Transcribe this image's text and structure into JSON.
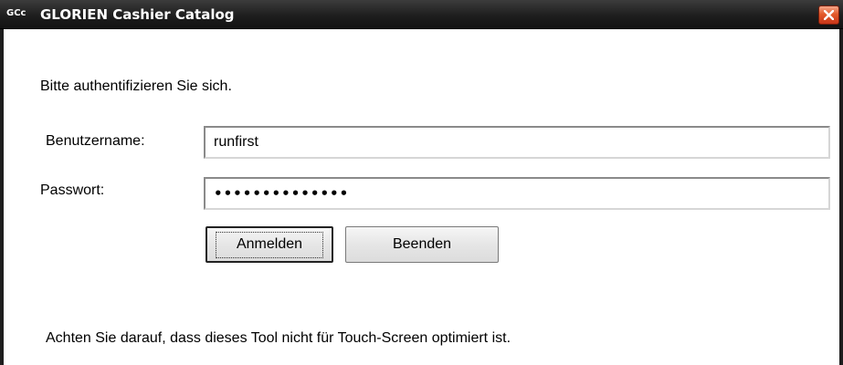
{
  "window": {
    "icon_text": "GCc",
    "title": "GLORIEN Cashier Catalog",
    "close_icon": "close-icon"
  },
  "login": {
    "prompt": "Bitte authentifizieren Sie sich.",
    "username_label": "Benutzername:",
    "username_value": "runfirst",
    "password_label": "Passwort:",
    "password_value": "••••••••••••••",
    "login_button": "Anmelden",
    "quit_button": "Beenden"
  },
  "footer_note": "Achten Sie darauf, dass dieses Tool nicht für Touch-Screen optimiert ist.",
  "colors": {
    "titlebar": "#1e1e1e",
    "close_button": "#e35a2a",
    "background": "#ffffff"
  }
}
